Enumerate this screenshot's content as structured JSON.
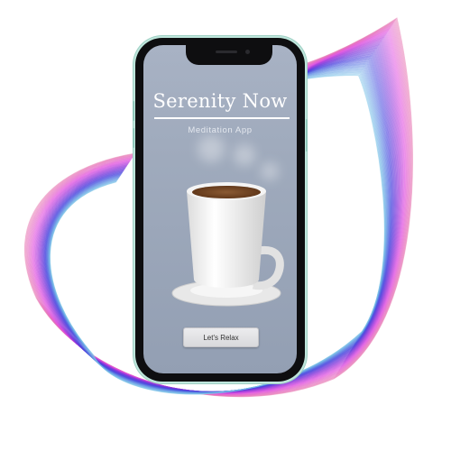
{
  "app": {
    "title": "Serenity Now",
    "subtitle": "Meditation App",
    "cta_label": "Let's Relax"
  },
  "colors": {
    "screen_background": "#a0abbd",
    "phone_body": "#0e0e10",
    "phone_trim": "#bfe6dc",
    "title_text": "#ffffff",
    "coffee": "#6b3f1f",
    "ribbon_pink": "#e79ab4",
    "ribbon_blue": "#8ab4e6"
  },
  "icons": {
    "hero": "coffee-cup-icon"
  }
}
